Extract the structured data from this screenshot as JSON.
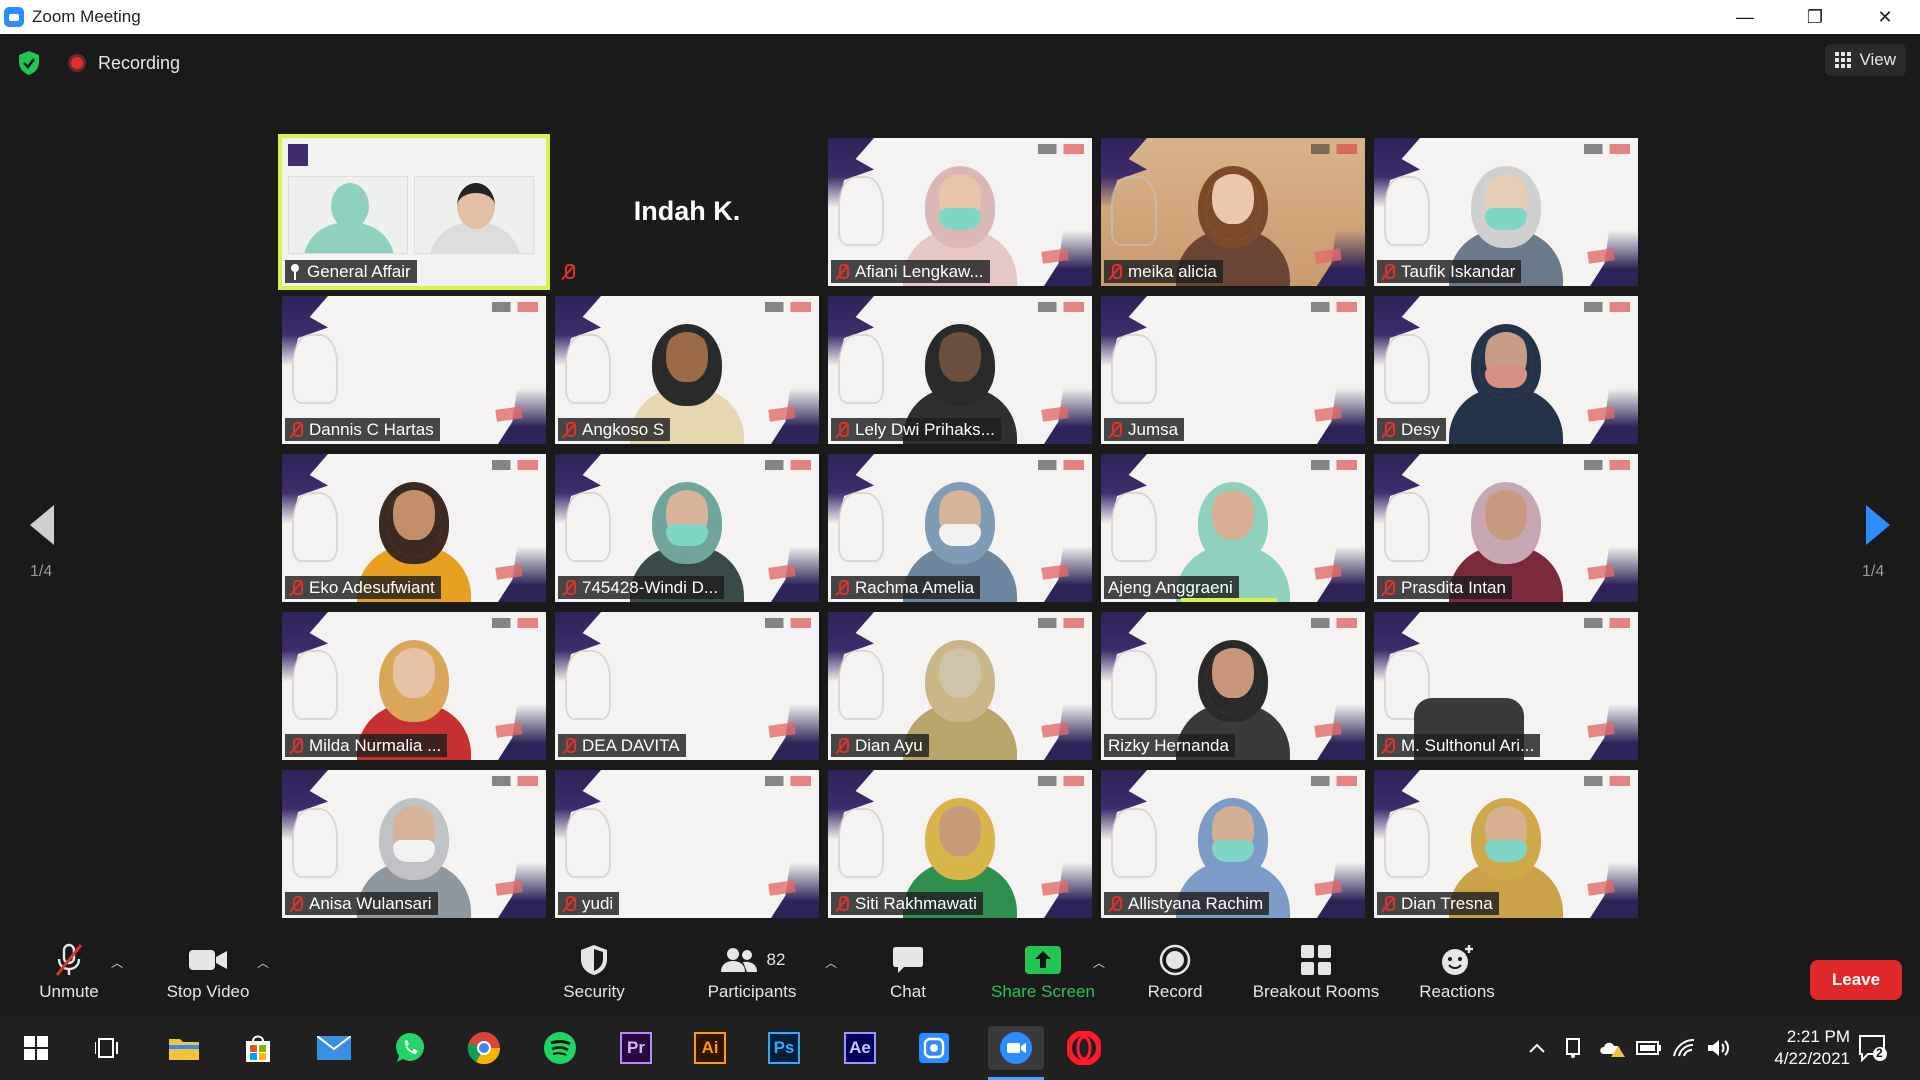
{
  "window": {
    "title": "Zoom Meeting",
    "minimize": "—",
    "restore": "❐",
    "close": "✕"
  },
  "topbar": {
    "recording_label": "Recording",
    "view_label": "View"
  },
  "pager": {
    "left": "1/4",
    "right": "1/4"
  },
  "tiles": [
    {
      "name": "General Affair",
      "type": "shared",
      "muted": false
    },
    {
      "name": "Indah K.",
      "type": "name-only",
      "muted": true
    },
    {
      "name": "Afiani Lengkaw...",
      "muted": true,
      "skin": "#e8c6a8",
      "hair": "#d9b7b5",
      "shirt": "#e7c6c6",
      "mask": true
    },
    {
      "name": "meika alicia",
      "muted": true,
      "skin": "#eac7ad",
      "hair": "#7a4a2a",
      "shirt": "#6a4434",
      "mask": false,
      "full": true
    },
    {
      "name": "Taufik Iskandar",
      "muted": true,
      "skin": "#e7cdb5",
      "hair": "#cfcfcf",
      "shirt": "#6b7a8a",
      "mask": true
    },
    {
      "name": "Dannis C Hartas",
      "muted": true,
      "empty": true
    },
    {
      "name": "Angkoso S",
      "muted": true,
      "skin": "#9b6a46",
      "hair": "#2a2a2a",
      "shirt": "#e6d7b0",
      "mask": false
    },
    {
      "name": "Lely Dwi Prihaks...",
      "muted": true,
      "skin": "#6b5040",
      "hair": "#2a2a2a",
      "shirt": "#2f2f2f",
      "mask": false
    },
    {
      "name": "Jumsa",
      "muted": true,
      "empty": true
    },
    {
      "name": "Desy",
      "muted": true,
      "skin": "#c79c87",
      "hair": "#24324a",
      "shirt": "#24324a",
      "mask": true,
      "mask_color": "#d58f83"
    },
    {
      "name": "Eko Adesufwiant",
      "muted": true,
      "skin": "#c48e68",
      "hair": "#3a2a22",
      "shirt": "#e8a020",
      "mask": false
    },
    {
      "name": "745428-Windi D...",
      "muted": true,
      "skin": "#d7b39a",
      "hair": "#6fa59a",
      "shirt": "#3a4a48",
      "mask": true
    },
    {
      "name": "Rachma Amelia",
      "muted": true,
      "skin": "#d7b39a",
      "hair": "#7f9bb5",
      "shirt": "#6d86a0",
      "mask": true,
      "mask_color": "#f2f2f2"
    },
    {
      "name": "Ajeng Anggraeni",
      "muted": false,
      "skin": "#d8b094",
      "hair": "#8fd1bf",
      "shirt": "#8fd1bf",
      "mask": false,
      "speaking": true
    },
    {
      "name": "Prasdita Intan",
      "muted": true,
      "skin": "#c79a80",
      "hair": "#c7a7b3",
      "shirt": "#7a2a3a",
      "mask": false
    },
    {
      "name": "Milda Nurmalia ...",
      "muted": true,
      "skin": "#e7c1a4",
      "hair": "#d9a75a",
      "shirt": "#c73030",
      "mask": false
    },
    {
      "name": "DEA DAVITA",
      "muted": true,
      "empty": true
    },
    {
      "name": "Dian Ayu",
      "muted": true,
      "skin": "#cfc3a8",
      "hair": "#c9b787",
      "shirt": "#b8a56a",
      "mask": false
    },
    {
      "name": "Rizky Hernanda",
      "muted": false,
      "skin": "#c8977a",
      "hair": "#2a2a2a",
      "shirt": "#3a3a3a",
      "mask": false
    },
    {
      "name": "M. Sulthonul Ari...",
      "muted": true,
      "empty": true,
      "chair": true
    },
    {
      "name": "Anisa Wulansari",
      "muted": true,
      "skin": "#d8b399",
      "hair": "#bfc3c6",
      "shirt": "#8f989e",
      "mask": true,
      "mask_color": "#f2f2f2"
    },
    {
      "name": "yudi",
      "muted": true,
      "empty": true
    },
    {
      "name": "Siti Rakhmawati",
      "muted": true,
      "skin": "#c79b7a",
      "hair": "#d8b54a",
      "shirt": "#2f8f4f",
      "mask": false
    },
    {
      "name": "Allistyana Rachim",
      "muted": true,
      "skin": "#d5ae96",
      "hair": "#7a9cc7",
      "shirt": "#7a9cc7",
      "mask": true
    },
    {
      "name": "Dian Tresna",
      "muted": true,
      "skin": "#d6b08f",
      "hair": "#cfa84a",
      "shirt": "#caa24a",
      "mask": true
    }
  ],
  "toolbar": {
    "unmute": "Unmute",
    "stop_video": "Stop Video",
    "security": "Security",
    "participants": "Participants",
    "participants_count": "82",
    "chat": "Chat",
    "share_screen": "Share Screen",
    "record": "Record",
    "breakout_rooms": "Breakout Rooms",
    "reactions": "Reactions",
    "leave": "Leave"
  },
  "taskbar": {
    "apps": [
      "start-icon",
      "task-view-icon",
      "file-explorer-icon",
      "store-icon",
      "mail-icon",
      "whatsapp-icon",
      "chrome-icon",
      "spotify-icon",
      "premiere-icon",
      "illustrator-icon",
      "photoshop-icon",
      "after-effects-icon",
      "camera-app-icon",
      "zoom-icon",
      "opera-icon"
    ],
    "premiere_label": "Pr",
    "illustrator_label": "Ai",
    "photoshop_label": "Ps",
    "after_effects_label": "Ae",
    "time": "2:21 PM",
    "date": "4/22/2021",
    "notif_count": "2"
  },
  "colors": {
    "accent": "#2d8cff",
    "leave": "#e02828",
    "share": "#23c552",
    "speaking": "#d7f24a",
    "muted": "#e0312e"
  }
}
